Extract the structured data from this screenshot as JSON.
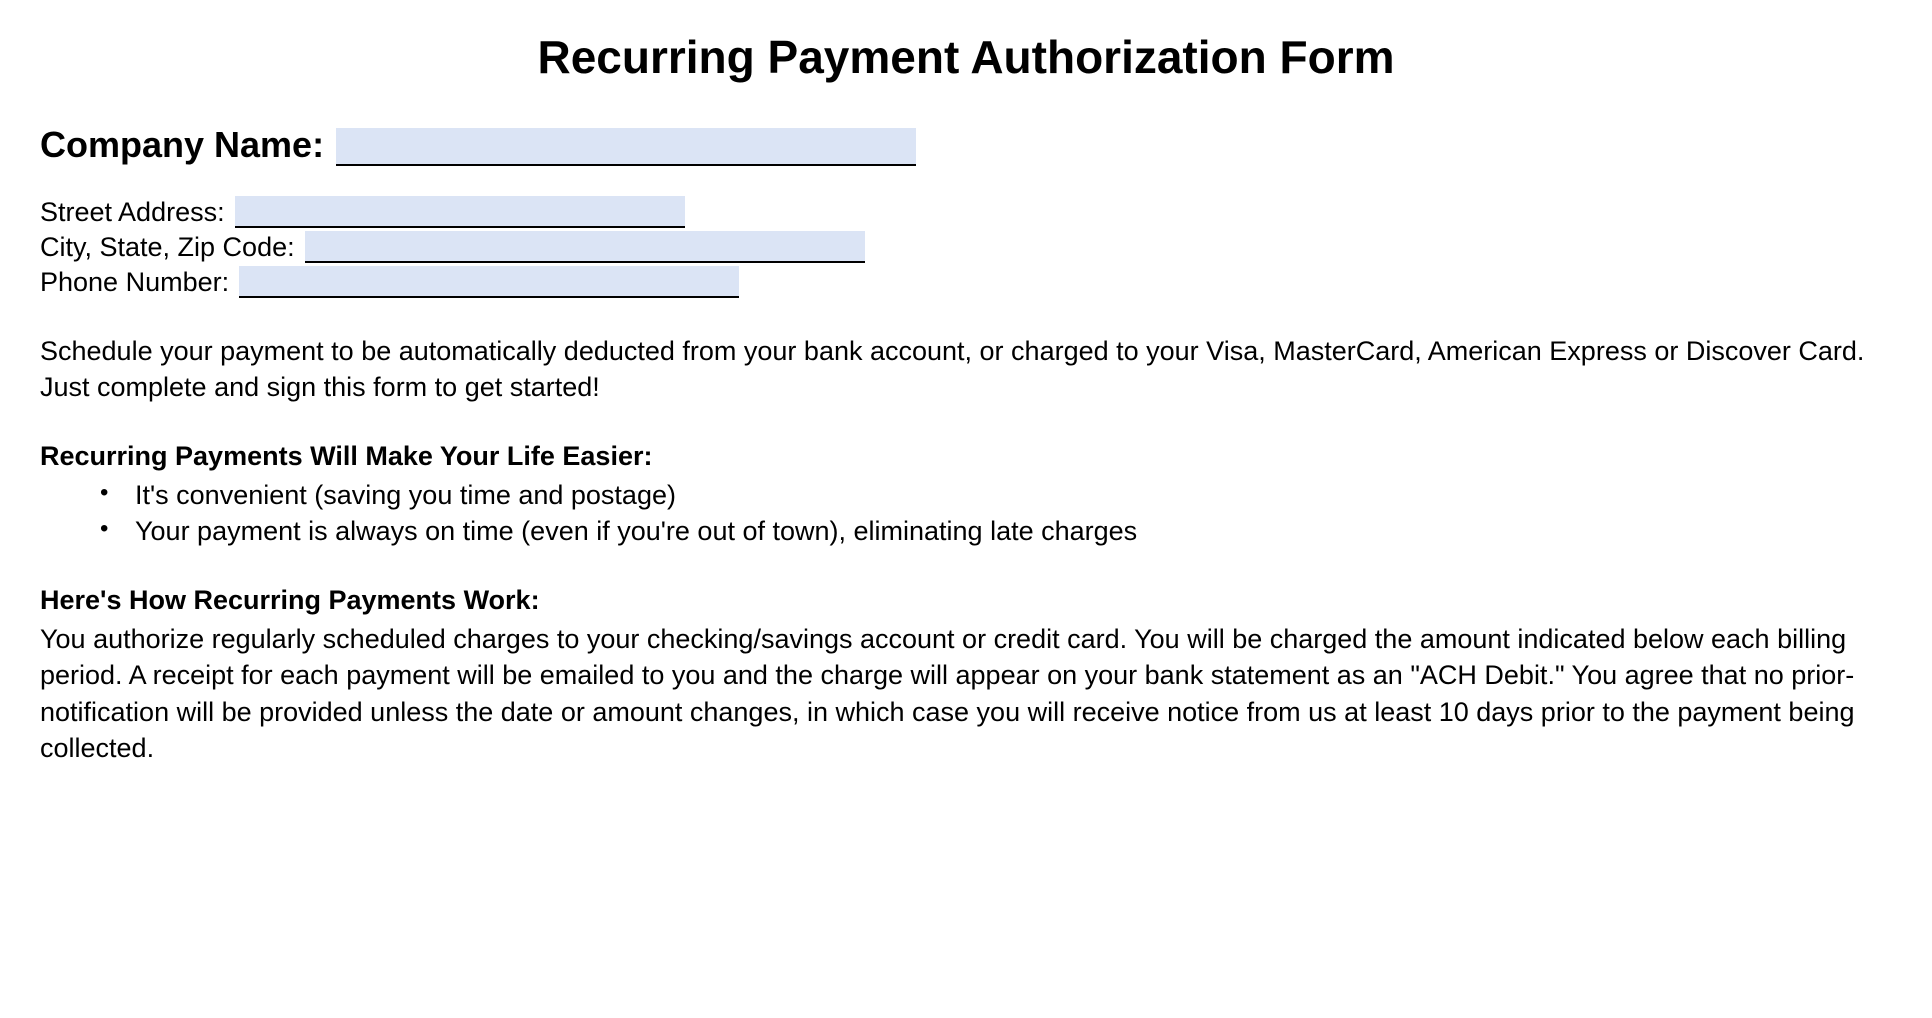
{
  "title": "Recurring Payment Authorization Form",
  "company": {
    "label": "Company Name:",
    "value": ""
  },
  "address": {
    "street_label": "Street Address:",
    "street_value": "",
    "city_label": "City, State, Zip Code:",
    "city_value": "",
    "phone_label": "Phone Number:",
    "phone_value": ""
  },
  "intro": "Schedule your payment to be automatically deducted from your bank account, or charged to your Visa, MasterCard, American Express or Discover Card.  Just complete and sign this form to get started!",
  "benefits": {
    "heading": "Recurring Payments Will Make Your Life Easier:",
    "items": [
      "It's convenient (saving you time and postage)",
      "Your payment is always on time (even if you're out of town), eliminating late charges"
    ]
  },
  "howItWorks": {
    "heading": "Here's How Recurring Payments Work:",
    "body": "You authorize regularly scheduled charges to your checking/savings account or credit card.  You will be charged the amount indicated below each billing period.  A receipt for each payment will be emailed to you and the charge will appear on your bank statement as an \"ACH Debit.\"  You agree that no prior-notification will be provided unless the date or amount changes, in which case you will receive notice from us at least 10 days prior to the payment being collected."
  }
}
